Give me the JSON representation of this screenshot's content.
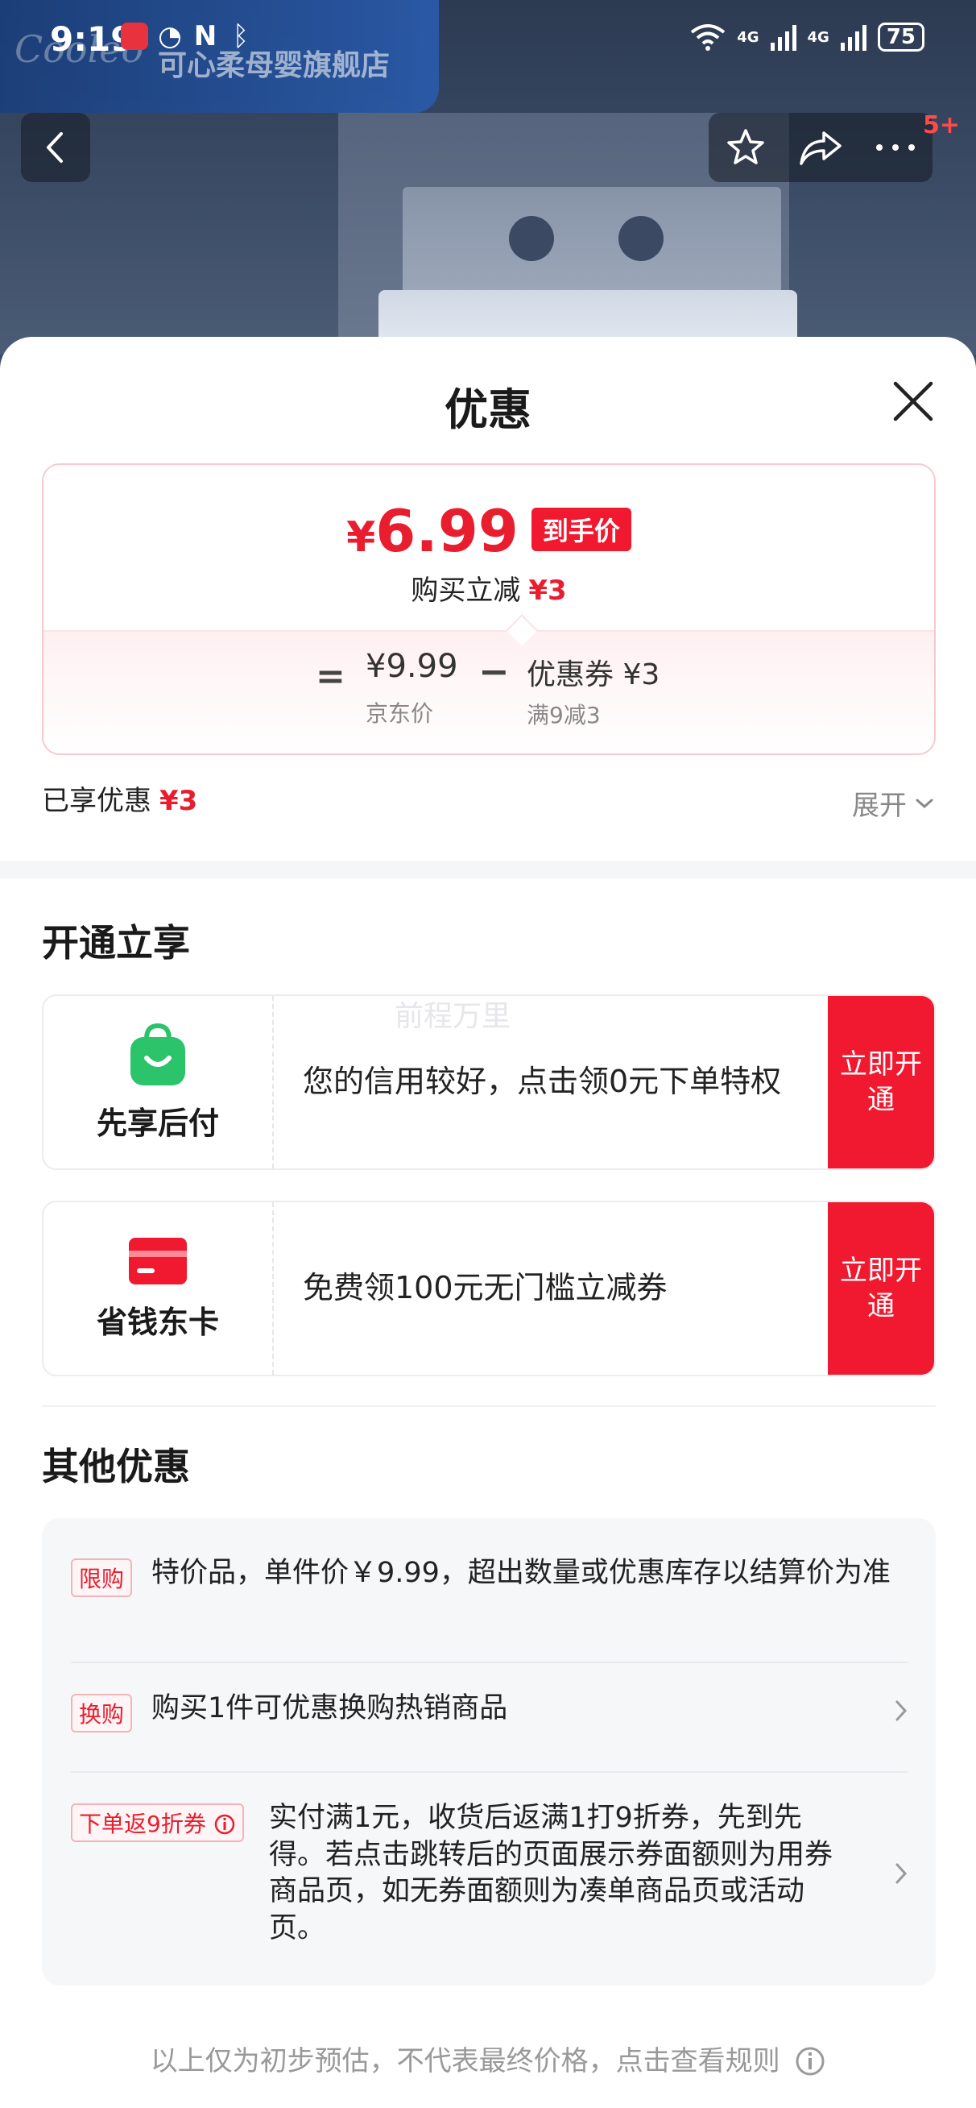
{
  "status_bar": {
    "time": "9:19",
    "network_a": "4G",
    "network_b": "4G",
    "battery": "75"
  },
  "store": {
    "logo_text": "Cooleo",
    "name": "可心柔母婴旗舰店"
  },
  "nav": {
    "notification_badge": "5+"
  },
  "sheet": {
    "title": "优惠"
  },
  "price_card": {
    "currency": "¥",
    "final_price": "6.99",
    "arrive_tag": "到手价",
    "instant_label": "购买立减",
    "instant_amount": "¥3",
    "equals": "=",
    "jd_price": "¥9.99",
    "jd_price_label": "京东价",
    "minus": "−",
    "coupon": "优惠券 ¥3",
    "coupon_rule": "满9减3"
  },
  "enjoyed": {
    "label": "已享优惠",
    "amount": "¥3",
    "expand_label": "展开"
  },
  "activate_section": {
    "title": "开通立享",
    "watermark": "前程万里",
    "items": [
      {
        "name": "先享后付",
        "icon": "shopping-bag-icon",
        "icon_color": "#2bc46b",
        "description": "您的信用较好，点击领0元下单特权",
        "button": "立即开通"
      },
      {
        "name": "省钱东卡",
        "icon": "card-icon",
        "icon_color": "#f0192f",
        "description": "免费领100元无门槛立减券",
        "button": "立即开通"
      }
    ]
  },
  "other_section": {
    "title": "其他优惠",
    "items": [
      {
        "tag": "限购",
        "text": "特价品，单件价￥9.99，超出数量或优惠库存以结算价为准"
      },
      {
        "tag": "换购",
        "text": "购买1件可优惠换购热销商品"
      },
      {
        "tag": "下单返9折券",
        "text": "实付满1元，收货后返满1打9折券，先到先得。若点击跳转后的页面展示券面额则为用券商品页，如无券面额则为凑单商品页或活动页。"
      }
    ]
  },
  "footer": {
    "note": "以上仅为初步预估，不代表最终价格，点击查看规则"
  },
  "colors": {
    "accent_red": "#e81e2e",
    "button_red": "#f0192f",
    "green": "#2bc46b"
  }
}
